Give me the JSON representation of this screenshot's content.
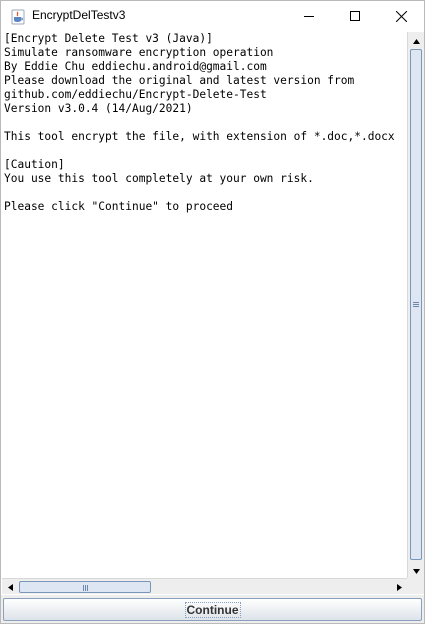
{
  "window": {
    "title": "EncryptDelTestv3"
  },
  "text_area": {
    "lines": [
      "[Encrypt Delete Test v3 (Java)]",
      "Simulate ransomware encryption operation",
      "By Eddie Chu eddiechu.android@gmail.com",
      "Please download the original and latest version from",
      "github.com/eddiechu/Encrypt-Delete-Test",
      "Version v3.0.4 (14/Aug/2021)",
      "",
      "This tool encrypt the file, with extension of *.doc,*.docx",
      "",
      "[Caution]",
      "You use this tool completely at your own risk.",
      "",
      "Please click \"Continue\" to proceed"
    ]
  },
  "button_bar": {
    "continue_label": "Continue"
  },
  "icons": {
    "app": "java-cup-icon",
    "minimize": "minimize-icon",
    "maximize": "maximize-icon",
    "close": "close-icon"
  }
}
